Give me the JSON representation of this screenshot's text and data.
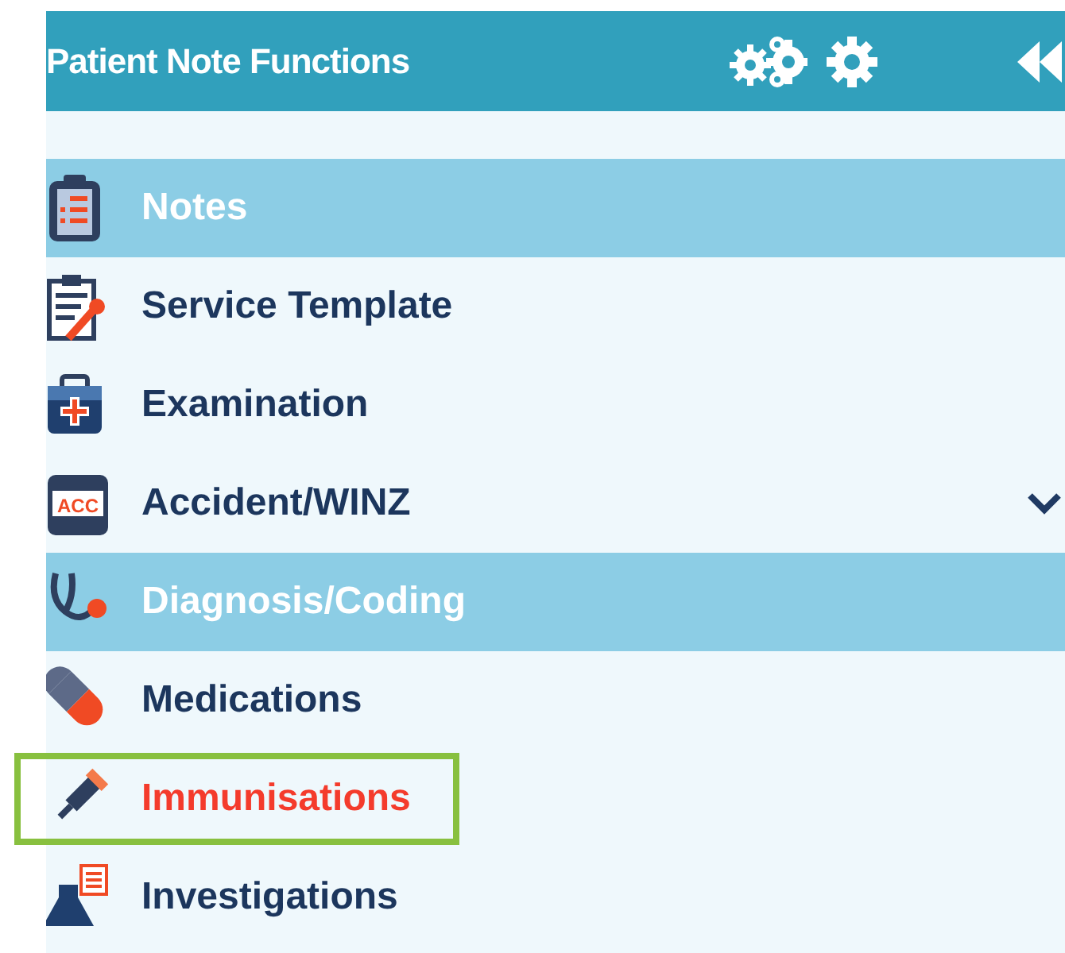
{
  "panel": {
    "title": "Patient Note Functions"
  },
  "items": [
    {
      "label": "Notes",
      "kind": "section",
      "selected": false,
      "expandable": false
    },
    {
      "label": "Service Template",
      "kind": "item",
      "selected": false,
      "expandable": false
    },
    {
      "label": "Examination",
      "kind": "item",
      "selected": false,
      "expandable": false
    },
    {
      "label": "Accident/WINZ",
      "kind": "item",
      "selected": false,
      "expandable": true,
      "badge": "ACC"
    },
    {
      "label": "Diagnosis/Coding",
      "kind": "section",
      "selected": false,
      "expandable": false
    },
    {
      "label": "Medications",
      "kind": "item",
      "selected": false,
      "expandable": false
    },
    {
      "label": "Immunisations",
      "kind": "item",
      "selected": true,
      "expandable": false
    },
    {
      "label": "Investigations",
      "kind": "item",
      "selected": false,
      "expandable": false
    }
  ]
}
